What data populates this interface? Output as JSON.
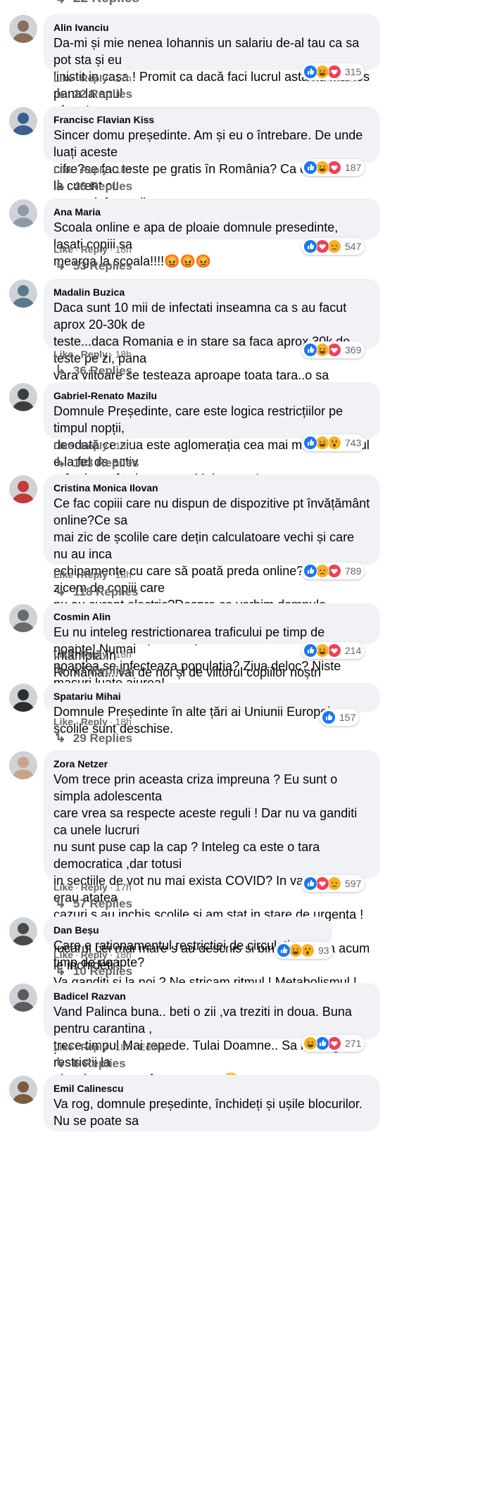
{
  "top_replies": "22 Replies",
  "labels": {
    "like": "Like",
    "reply": "Reply",
    "sep": "·"
  },
  "comments": [
    {
      "author": "Alin Ivanciu",
      "text": "Da-mi și mie nenea Iohannis un salariu de-al tau ca sa pot sta și eu\nlinistit in casa ! Promit ca dacă faci lucrul asta nu mai ies pana la anul\nafara !",
      "time": "17h",
      "edited": "",
      "count": "315",
      "reactions": [
        "like",
        "haha",
        "love"
      ],
      "replies": "12 Replies",
      "avatar": "#8a6d5a"
    },
    {
      "author": "Francisc Flavian Kiss",
      "text": "Sincer domu președinte. Am și eu o întrebare. De unde luați aceste\ncifre?se fac teste pe gratis în România? Ca eu nu sunt la curent cu\naceste informații.",
      "time": "18h",
      "edited": "",
      "count": "187",
      "reactions": [
        "like",
        "haha",
        "love"
      ],
      "replies": "46 Replies",
      "avatar": "#3b5e8c"
    },
    {
      "author": "Ana Maria",
      "text": "Scoala online e apa de ploaie domnule presedinte, lasati copiii sa\nmearga la scoala!!!!😡😡😡",
      "time": "18h",
      "edited": "",
      "count": "547",
      "reactions": [
        "like",
        "love",
        "sad"
      ],
      "replies": "53 Replies",
      "avatar": "#8f9aa6"
    },
    {
      "author": "Madalin Buzica",
      "text": "Daca sunt 10 mii de infectati inseamna ca s au facut aprox 20-30k de\nteste...daca Romania e in stare sa faca aprox 30k de teste pe zi, pana\nvara viitoare se testeaza aproape toata tara..o sa ramanem fara\ninfectati!!! 😅",
      "time": "18h",
      "edited": "",
      "count": "369",
      "reactions": [
        "like",
        "haha",
        "love"
      ],
      "replies": "36 Replies",
      "avatar": "#5a7a8c"
    },
    {
      "author": "Gabriel-Renato Mazilu",
      "text": "Domnule Președinte, care este logica restricțiilor pe timpul nopții,\ndeodată ce ziua este aglomerația cea mai mare? Virusul e la fel de activ\natât ziua, cât și noaptea. Mulțumesc!",
      "time": "18h",
      "edited": "",
      "count": "743",
      "reactions": [
        "like",
        "haha",
        "wow"
      ],
      "replies": "103 Replies",
      "avatar": "#3d3d3d"
    },
    {
      "author": "Cristina Monica Ilovan",
      "text": "Ce fac copiii care nu dispun de dispozitive pt învățământ online?Ce sa\nmai zic de școlile care dețin calculatoare vechi și care nu au inca\nechipamente cu care să poată preda online?Ce sa zicem de copiii care\nnu au curent electric?Despre ce vorbim domnule președinte?habar nu\naveți s au nu vreți să aveți habar de ceea ce se întâmplă în\nRomânia....vai de noi și de viitorul copiilor noștri",
      "time": "18h",
      "edited": "",
      "count": "789",
      "reactions": [
        "like",
        "sad",
        "love"
      ],
      "replies": "118 Replies",
      "avatar": "#c23a3a"
    },
    {
      "author": "Cosmin Alin",
      "text": "Eu nu inteleg restrictionarea traficului pe timp de noapte! Numai\nnoaptea se infecteaza populatia? Ziua deloc? Niste masuri luate aiurea!",
      "time": "18h",
      "edited": "",
      "count": "214",
      "reactions": [
        "like",
        "haha",
        "love"
      ],
      "replies": "17 Replies",
      "avatar": "#6b6b6b"
    },
    {
      "author": "Spatariu Mihai",
      "text": "Domnule Președinte în alte țări ai Uniunii Europei, școlile sunt deschise.",
      "time": "18h",
      "edited": "",
      "count": "157",
      "reactions": [
        "like"
      ],
      "replies": "29 Replies",
      "avatar": "#2e2e2e"
    },
    {
      "author": "Zora Netzer",
      "text": "Vom trece prin aceasta criza impreuna ? Eu sunt o simpla adolescenta\ncare vrea sa respecte aceste reguli ! Dar nu va ganditi ca unele lucruri\nnu sunt puse cap la cap ? Inteleg ca este o tara democratica ,dar totusi\nin sectiile de vot nu mai exista COVID? In vara cand nu erau atatea\ncazuri s au inchis scolile si am stat in stare de urgenta ! Acum cand era\nfocarul cel mai mare s au deschis si bineinteles ca acum le inchideti !\nVa ganditi si la noi ? Ne stricam ritmul ! Metabolismul ! Programul! Si\nnu mai zic ca la ce invatamant online avem o sa fim un viitor de inculti\n!",
      "time": "17h",
      "edited": "",
      "count": "597",
      "reactions": [
        "like",
        "love",
        "sad"
      ],
      "replies": "57 Replies",
      "avatar": "#c9a48a"
    },
    {
      "author": "Dan Beșu",
      "text": "Care e rationamentul restrictiei de circulatie pe timp de noapte?",
      "time": "18h",
      "edited": "",
      "count": "93",
      "reactions": [
        "like",
        "haha",
        "wow"
      ],
      "replies": "10 Replies",
      "avatar": "#4a4a4a"
    },
    {
      "author": "Badicel Razvan",
      "text": "Vand Palinca buna.. beti o zii ,va treziti in doua. Buna pentru carantina ,\ntrece timpul Mai repede. Tulai Doamne.. Sa nu bagati restrictii la\nalcoale ca pe .. afacerea mea 😄",
      "time": "18h",
      "edited": "Edited",
      "count": "271",
      "reactions": [
        "haha",
        "like",
        "love"
      ],
      "replies": "6 Replies",
      "avatar": "#5c5c5c"
    },
    {
      "author": "Emil Calinescu",
      "text": "Va rog, domnule președinte, închideți și ușile blocurilor. Nu se poate sa",
      "time": "",
      "edited": "",
      "count": "",
      "reactions": [],
      "replies": "",
      "avatar": "#7a5c3e"
    }
  ]
}
